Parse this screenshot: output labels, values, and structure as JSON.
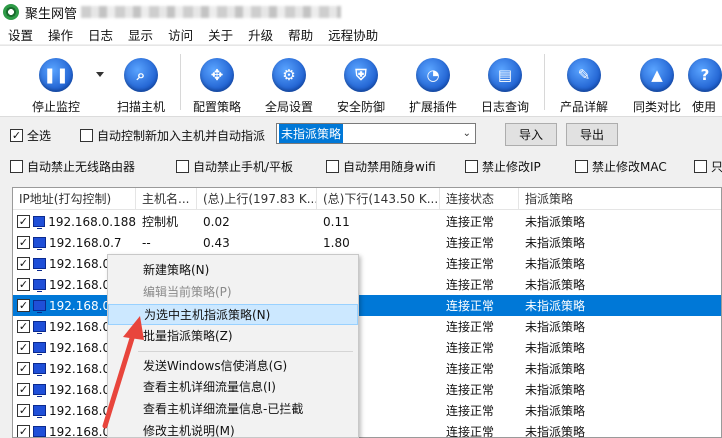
{
  "titlebar": {
    "title": "聚生网管"
  },
  "menu": [
    "设置",
    "操作",
    "日志",
    "显示",
    "访问",
    "关于",
    "升级",
    "帮助",
    "远程协助"
  ],
  "toolbar": {
    "items": [
      {
        "label": "停止监控",
        "icon": "pause-icon",
        "glyph": "❚❚"
      },
      {
        "label": "扫描主机",
        "icon": "scan-search-icon",
        "glyph": "⌕"
      },
      {
        "label": "配置策略",
        "icon": "policy-config-icon",
        "glyph": "✥"
      },
      {
        "label": "全局设置",
        "icon": "gear-icon",
        "glyph": "⚙"
      },
      {
        "label": "安全防御",
        "icon": "shield-icon",
        "glyph": "⛨"
      },
      {
        "label": "扩展插件",
        "icon": "plugin-chart-icon",
        "glyph": "◔"
      },
      {
        "label": "日志查询",
        "icon": "log-query-icon",
        "glyph": "▤"
      },
      {
        "label": "产品详解",
        "icon": "edit-doc-icon",
        "glyph": "✎"
      },
      {
        "label": "同类对比",
        "icon": "graduation-cap-icon",
        "glyph": "▲"
      },
      {
        "label": "使用",
        "icon": "help-icon",
        "glyph": "?"
      }
    ]
  },
  "options1": {
    "all_label": "全选",
    "auto_label": "自动控制新加入主机并自动指派",
    "policy_value": "未指派策略",
    "import_label": "导入",
    "export_label": "导出"
  },
  "options2": [
    "自动禁止无线路由器",
    "自动禁止手机/平板",
    "自动禁用随身wifi",
    "禁止修改IP",
    "禁止修改MAC",
    "只"
  ],
  "table": {
    "headers": [
      "IP地址(打勾控制)",
      "主机名...",
      "(总)上行(197.83 K...",
      "(总)下行(143.50 K...",
      "连接状态",
      "指派策略"
    ],
    "rows": [
      {
        "ip": "192.168.0.188",
        "host": "控制机",
        "up": "0.02",
        "down": "0.11",
        "status": "连接正常",
        "policy": "未指派策略"
      },
      {
        "ip": "192.168.0.7",
        "host": "--",
        "up": "0.43",
        "down": "1.80",
        "status": "连接正常",
        "policy": "未指派策略"
      },
      {
        "ip": "192.168.0.",
        "host": "",
        "up": "",
        "down": "",
        "status": "连接正常",
        "policy": "未指派策略"
      },
      {
        "ip": "192.168.0.",
        "host": "",
        "up": "",
        "down": "",
        "status": "连接正常",
        "policy": "未指派策略"
      },
      {
        "ip": "192.168.0.",
        "host": "",
        "up": "",
        "down": "",
        "status": "连接正常",
        "policy": "未指派策略"
      },
      {
        "ip": "192.168.0.",
        "host": "",
        "up": "",
        "down": "",
        "status": "连接正常",
        "policy": "未指派策略"
      },
      {
        "ip": "192.168.0.",
        "host": "",
        "up": "",
        "down": "",
        "status": "连接正常",
        "policy": "未指派策略"
      },
      {
        "ip": "192.168.0.",
        "host": "",
        "up": "",
        "down": "",
        "status": "连接正常",
        "policy": "未指派策略"
      },
      {
        "ip": "192.168.0.",
        "host": "",
        "up": "",
        "down": "",
        "status": "连接正常",
        "policy": "未指派策略"
      },
      {
        "ip": "192.168.0.",
        "host": "",
        "up": "",
        "down": "",
        "status": "连接正常",
        "policy": "未指派策略"
      },
      {
        "ip": "192.168.0.",
        "host": "",
        "up": "",
        "down": "",
        "status": "连接正常",
        "policy": "未指派策略"
      }
    ]
  },
  "context_menu": {
    "items": [
      "新建策略(N)",
      "编辑当前策略(P)",
      "为选中主机指派策略(N)",
      "批量指派策略(Z)",
      "发送Windows信使消息(G)",
      "查看主机详细流量信息(I)",
      "查看主机详细流量信息-已拦截",
      "修改主机说明(M)"
    ]
  },
  "colors": {
    "selection": "#0078d7",
    "arrow": "#e8453c",
    "menu_highlight": "#cce8ff"
  }
}
